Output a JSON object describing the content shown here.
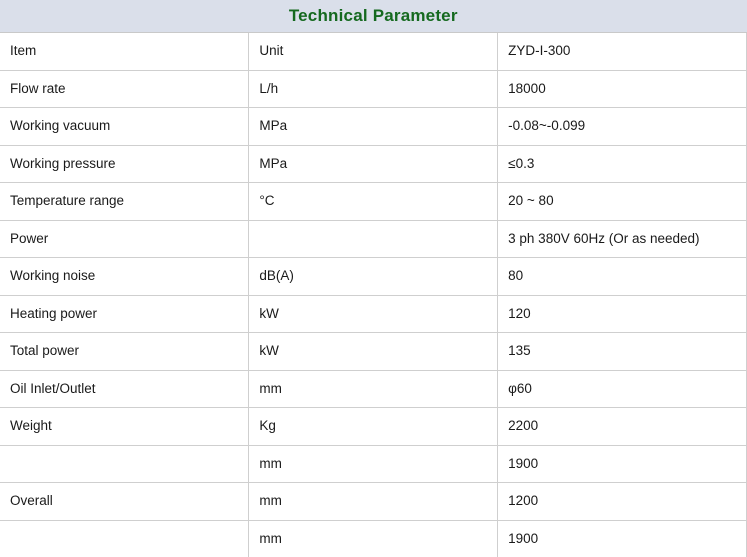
{
  "table": {
    "title": "Technical Parameter",
    "title_color": "#15691f",
    "title_background": "#dadfea",
    "border_color": "#cfcfcf",
    "columns": [
      "Item",
      "Unit",
      "ZYD-I-300"
    ],
    "rows": [
      {
        "item": "Item",
        "unit": "Unit",
        "value": "ZYD-I-300"
      },
      {
        "item": "Flow rate",
        "unit": "L/h",
        "value": "18000"
      },
      {
        "item": "Working vacuum",
        "unit": "MPa",
        "value": "-0.08~-0.099"
      },
      {
        "item": "Working pressure",
        "unit": "MPa",
        "value": "≤0.3"
      },
      {
        "item": "Temperature range",
        "unit": "°C",
        "value": "20 ~ 80"
      },
      {
        "item": "Power",
        "unit": "",
        "value": "3 ph 380V 60Hz (Or as needed)"
      },
      {
        "item": "Working noise",
        "unit": "dB(A)",
        "value": "80"
      },
      {
        "item": "Heating power",
        "unit": "kW",
        "value": "120"
      },
      {
        "item": "Total power",
        "unit": "kW",
        "value": "135"
      },
      {
        "item": "Oil Inlet/Outlet",
        "unit": "mm",
        "value": "φ60"
      },
      {
        "item": "Weight",
        "unit": "Kg",
        "value": "2200"
      },
      {
        "item": "",
        "unit": "mm",
        "value": "1900"
      },
      {
        "item": "Overall",
        "unit": "mm",
        "value": "1200"
      },
      {
        "item": "",
        "unit": "mm",
        "value": "1900"
      }
    ]
  }
}
